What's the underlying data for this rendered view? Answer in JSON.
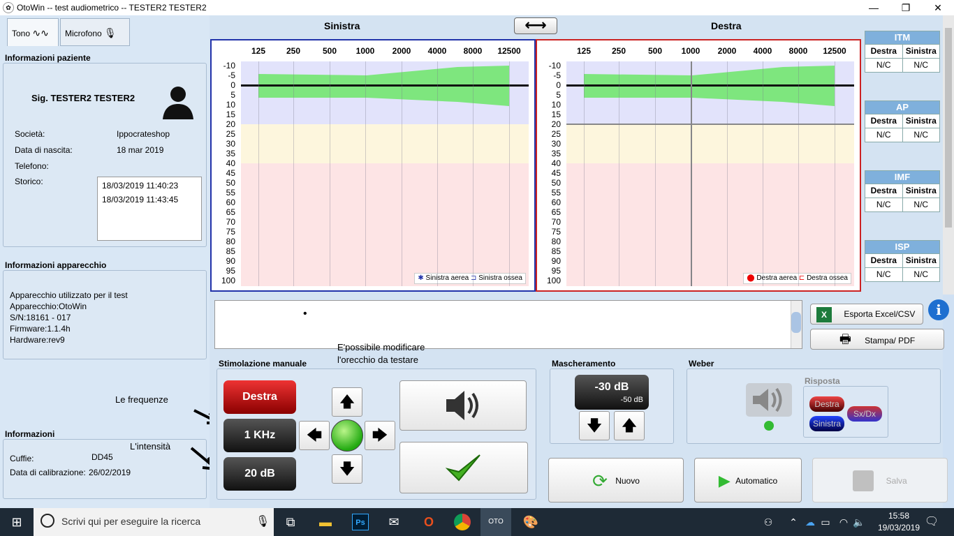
{
  "window": {
    "title": "OtoWin -- test audiometrico -- TESTER2 TESTER2",
    "minimize": "—",
    "restore": "❐",
    "close": "✕"
  },
  "tabs": [
    {
      "label": "Tono"
    },
    {
      "label": "Microfono"
    }
  ],
  "patient": {
    "section_title": "Informazioni paziente",
    "name": "Sig. TESTER2 TESTER2",
    "societa_label": "Società:",
    "societa": "Ippocrateshop",
    "birth_label": "Data di nascita:",
    "birth": "18 mar 2019",
    "phone_label": "Telefono:",
    "history_label": "Storico:",
    "history": [
      "18/03/2019 11:40:23",
      "18/03/2019 11:43:45"
    ]
  },
  "device": {
    "section_title": "Informazioni apparecchio",
    "lines": [
      "Apparecchio utilizzato per il test",
      "Apparecchio:OtoWin",
      "S/N:18161 - 017",
      "Firmware:1.1.4h",
      "Hardware:rev9"
    ]
  },
  "info": {
    "section_title": "Informazioni",
    "cuffie_label": "Cuffie:",
    "cuffie": "DD45",
    "calib_label": "Data di calibrazione:",
    "calib": "26/02/2019"
  },
  "annotations": {
    "frequenze": "Le frequenze",
    "intensita": "L'intensità",
    "modifica_line1": "E'possibile modificare",
    "modifica_line2": "l'orecchio da testare"
  },
  "charts": {
    "left_title": "Sinistra",
    "right_title": "Destra",
    "swap_icon": "⟷",
    "freqs": [
      "125",
      "250",
      "500",
      "1000",
      "2000",
      "4000",
      "8000",
      "12500"
    ],
    "db": [
      "-10",
      "-5",
      "0",
      "5",
      "10",
      "15",
      "20",
      "25",
      "30",
      "35",
      "40",
      "45",
      "50",
      "55",
      "60",
      "65",
      "70",
      "75",
      "80",
      "85",
      "90",
      "95",
      "100"
    ],
    "left_legend": {
      "air": "Sinistra aerea",
      "bone": "Sinistra ossea"
    },
    "right_legend": {
      "air": "Destra aerea",
      "bone": "Destra ossea"
    },
    "left_color": "#2233aa",
    "right_color": "#cc2222"
  },
  "summary": [
    {
      "title": "ITM",
      "c1": "Destra",
      "c2": "Sinistra",
      "v1": "N/C",
      "v2": "N/C"
    },
    {
      "title": "AP",
      "c1": "Destra",
      "c2": "Sinistra",
      "v1": "N/C",
      "v2": "N/C"
    },
    {
      "title": "IMF",
      "c1": "Destra",
      "c2": "Sinistra",
      "v1": "N/C",
      "v2": "N/C"
    },
    {
      "title": "ISP",
      "c1": "Destra",
      "c2": "Sinistra",
      "v1": "N/C",
      "v2": "N/C"
    }
  ],
  "export": {
    "excel": "Esporta Excel/CSV",
    "pdf": "Stampa/ PDF"
  },
  "stim": {
    "title": "Stimolazione manuale",
    "ear": "Destra",
    "freq": "1 KHz",
    "level": "20 dB"
  },
  "mask": {
    "title": "Mascheramento",
    "value": "-30 dB",
    "sub": "-50 dB"
  },
  "weber": {
    "title": "Weber",
    "risposta": "Risposta",
    "destra": "Destra",
    "sinistra": "Sinistra",
    "sxdx": "Sx/Dx"
  },
  "actions": {
    "nuovo": "Nuovo",
    "automatico": "Automatico",
    "salva": "Salva"
  },
  "taskbar": {
    "search": "Scrivi qui per eseguire la ricerca",
    "time": "15:58",
    "date": "19/03/2019"
  }
}
